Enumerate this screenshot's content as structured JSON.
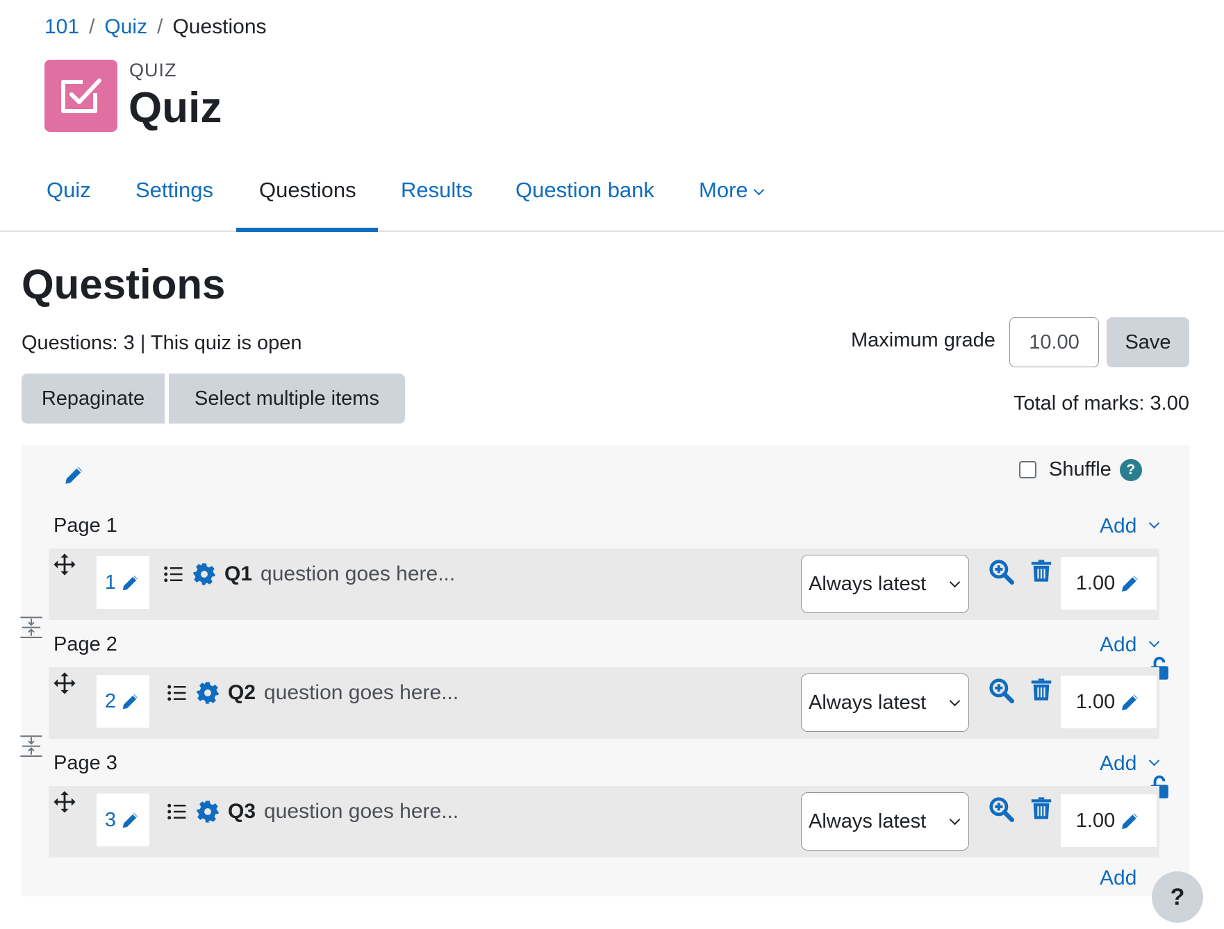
{
  "breadcrumb": {
    "items": [
      "101",
      "Quiz"
    ],
    "current": "Questions",
    "separator": "/"
  },
  "module": {
    "type": "QUIZ",
    "title": "Quiz",
    "icon": "checkbox-icon",
    "icon_color": "#e06fa2"
  },
  "tabs": [
    {
      "label": "Quiz"
    },
    {
      "label": "Settings"
    },
    {
      "label": "Questions"
    },
    {
      "label": "Results"
    },
    {
      "label": "Question bank"
    },
    {
      "label": "More"
    }
  ],
  "heading": "Questions",
  "status": "Questions: 3 | This quiz is open",
  "grade": {
    "label": "Maximum grade",
    "value": "10.00",
    "save_label": "Save"
  },
  "actions": {
    "repaginate": "Repaginate",
    "select_multiple": "Select multiple items"
  },
  "total_marks": "Total of marks: 3.00",
  "shuffle": {
    "label": "Shuffle",
    "checked": false,
    "help": "?"
  },
  "add_label": "Add",
  "pages": [
    {
      "label": "Page 1",
      "slot": {
        "number": "1",
        "name": "Q1",
        "text": "question goes here...",
        "version": "Always latest",
        "mark": "1.00"
      }
    },
    {
      "label": "Page 2",
      "slot": {
        "number": "2",
        "name": "Q2",
        "text": "question goes here...",
        "version": "Always latest",
        "mark": "1.00"
      }
    },
    {
      "label": "Page 3",
      "slot": {
        "number": "3",
        "name": "Q3",
        "text": "question goes here...",
        "version": "Always latest",
        "mark": "1.00"
      }
    }
  ],
  "colors": {
    "link": "#0f6cbf",
    "button_bg": "#ced4da",
    "panel_bg": "#f7f7f7",
    "slot_bg": "#e9e9e9"
  },
  "help_button": "?"
}
